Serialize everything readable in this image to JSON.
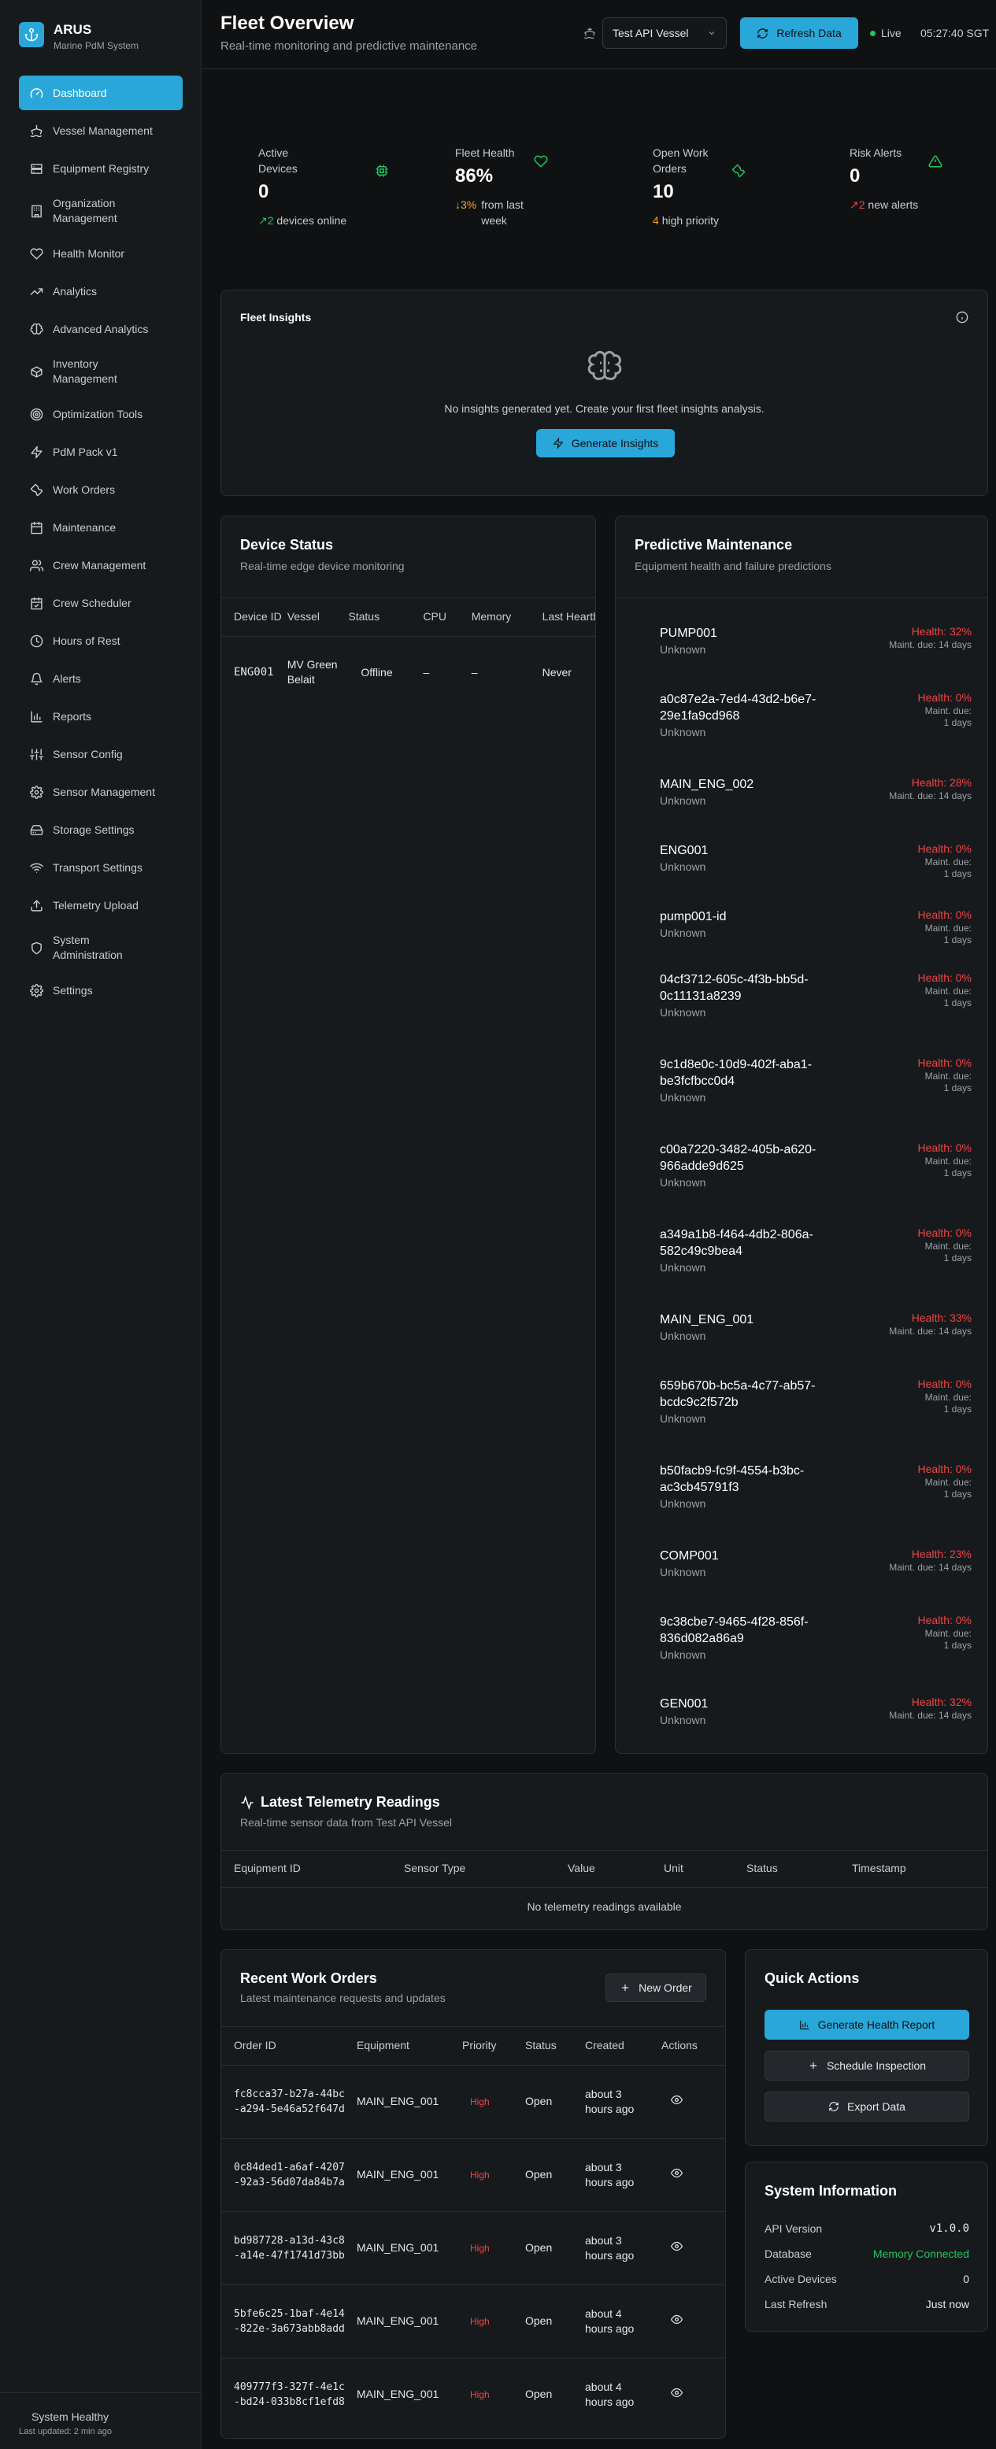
{
  "brand": {
    "name": "ARUS",
    "subtitle": "Marine PdM System"
  },
  "nav": [
    {
      "label": "Dashboard",
      "icon": "gauge-icon",
      "active": true
    },
    {
      "label": "Vessel Management",
      "icon": "ship-icon"
    },
    {
      "label": "Equipment Registry",
      "icon": "server-icon"
    },
    {
      "label": "Organization Management",
      "icon": "building-icon"
    },
    {
      "label": "Health Monitor",
      "icon": "heart-icon"
    },
    {
      "label": "Analytics",
      "icon": "trending-up-icon"
    },
    {
      "label": "Advanced Analytics",
      "icon": "brain-icon"
    },
    {
      "label": "Inventory Management",
      "icon": "package-icon"
    },
    {
      "label": "Optimization Tools",
      "icon": "target-icon"
    },
    {
      "label": "PdM Pack v1",
      "icon": "zap-icon"
    },
    {
      "label": "Work Orders",
      "icon": "wrench-icon"
    },
    {
      "label": "Maintenance",
      "icon": "calendar-icon"
    },
    {
      "label": "Crew Management",
      "icon": "users-icon"
    },
    {
      "label": "Crew Scheduler",
      "icon": "calendar-check-icon"
    },
    {
      "label": "Hours of Rest",
      "icon": "clock-icon"
    },
    {
      "label": "Alerts",
      "icon": "bell-icon"
    },
    {
      "label": "Reports",
      "icon": "bar-chart-icon"
    },
    {
      "label": "Sensor Config",
      "icon": "sliders-icon"
    },
    {
      "label": "Sensor Management",
      "icon": "gear-icon"
    },
    {
      "label": "Storage Settings",
      "icon": "hard-drive-icon"
    },
    {
      "label": "Transport Settings",
      "icon": "wifi-icon"
    },
    {
      "label": "Telemetry Upload",
      "icon": "upload-icon"
    },
    {
      "label": "System Administration",
      "icon": "shield-icon"
    },
    {
      "label": "Settings",
      "icon": "gear-icon"
    }
  ],
  "sidebar_footer": {
    "status": "System Healthy",
    "updated": "Last updated: 2 min ago"
  },
  "header": {
    "title": "Fleet Overview",
    "subtitle": "Real-time monitoring and predictive maintenance",
    "vessel": "Test API Vessel",
    "refresh_label": "Refresh Data",
    "live_label": "Live",
    "clock": "05:27:40 SGT"
  },
  "stats": [
    {
      "label": "Active Devices",
      "value": "0",
      "delta": "↗2",
      "note": "devices online"
    },
    {
      "label": "Fleet Health",
      "value": "86%",
      "delta": "↓3%",
      "note": "from last week"
    },
    {
      "label": "Open Work Orders",
      "value": "10",
      "delta": "4",
      "note": "high priority"
    },
    {
      "label": "Risk Alerts",
      "value": "0",
      "delta": "↗2",
      "note": "new alerts"
    }
  ],
  "insights": {
    "title": "Fleet Insights",
    "empty": "No insights generated yet. Create your first fleet insights analysis.",
    "button": "Generate Insights"
  },
  "device_status": {
    "title": "Device Status",
    "subtitle": "Real-time edge device monitoring",
    "columns": [
      "Device ID",
      "Vessel",
      "Status",
      "CPU",
      "Memory",
      "Last Heartbeat"
    ],
    "rows": [
      {
        "id": "ENG001",
        "vessel": "MV Green Belait",
        "status": "Offline",
        "cpu": "–",
        "memory": "–",
        "heartbeat": "Never"
      }
    ]
  },
  "predictive": {
    "title": "Predictive Maintenance",
    "subtitle": "Equipment health and failure predictions",
    "items": [
      {
        "name": "PUMP001",
        "state": "Unknown",
        "health": "Health: 32%",
        "due": "Maint. due: 14 days"
      },
      {
        "name": "a0c87e2a-7ed4-43d2-b6e7-29e1fa9cd968",
        "state": "Unknown",
        "health": "Health: 0%",
        "due": "Maint. due: 1 days"
      },
      {
        "name": "MAIN_ENG_002",
        "state": "Unknown",
        "health": "Health: 28%",
        "due": "Maint. due: 14 days"
      },
      {
        "name": "ENG001",
        "state": "Unknown",
        "health": "Health: 0%",
        "due": "Maint. due: 1 days"
      },
      {
        "name": "pump001-id",
        "state": "Unknown",
        "health": "Health: 0%",
        "due": "Maint. due: 1 days"
      },
      {
        "name": "04cf3712-605c-4f3b-bb5d-0c11131a8239",
        "state": "Unknown",
        "health": "Health: 0%",
        "due": "Maint. due: 1 days"
      },
      {
        "name": "9c1d8e0c-10d9-402f-aba1-be3fcfbcc0d4",
        "state": "Unknown",
        "health": "Health: 0%",
        "due": "Maint. due: 1 days"
      },
      {
        "name": "c00a7220-3482-405b-a620-966adde9d625",
        "state": "Unknown",
        "health": "Health: 0%",
        "due": "Maint. due: 1 days"
      },
      {
        "name": "a349a1b8-f464-4db2-806a-582c49c9bea4",
        "state": "Unknown",
        "health": "Health: 0%",
        "due": "Maint. due: 1 days"
      },
      {
        "name": "MAIN_ENG_001",
        "state": "Unknown",
        "health": "Health: 33%",
        "due": "Maint. due: 14 days"
      },
      {
        "name": "659b670b-bc5a-4c77-ab57-bcdc9c2f572b",
        "state": "Unknown",
        "health": "Health: 0%",
        "due": "Maint. due: 1 days"
      },
      {
        "name": "b50facb9-fc9f-4554-b3bc-ac3cb45791f3",
        "state": "Unknown",
        "health": "Health: 0%",
        "due": "Maint. due: 1 days"
      },
      {
        "name": "COMP001",
        "state": "Unknown",
        "health": "Health: 23%",
        "due": "Maint. due: 14 days"
      },
      {
        "name": "9c38cbe7-9465-4f28-856f-836d082a86a9",
        "state": "Unknown",
        "health": "Health: 0%",
        "due": "Maint. due: 1 days"
      },
      {
        "name": "GEN001",
        "state": "Unknown",
        "health": "Health: 32%",
        "due": "Maint. due: 14 days"
      }
    ]
  },
  "telemetry": {
    "title": "Latest Telemetry Readings",
    "subtitle": "Real-time sensor data from Test API Vessel",
    "columns": [
      "Equipment ID",
      "Sensor Type",
      "Value",
      "Unit",
      "Status",
      "Timestamp"
    ],
    "empty": "No telemetry readings available"
  },
  "work_orders": {
    "title": "Recent Work Orders",
    "subtitle": "Latest maintenance requests and updates",
    "new_button": "New Order",
    "columns": [
      "Order ID",
      "Equipment",
      "Priority",
      "Status",
      "Created",
      "Actions"
    ],
    "rows": [
      {
        "id": "fc8cca37-b27a-44bc-a294-5e46a52f647d",
        "equipment": "MAIN_ENG_001",
        "priority": "High",
        "status": "Open",
        "created": "about 3 hours ago"
      },
      {
        "id": "0c84ded1-a6af-4207-92a3-56d07da84b7a",
        "equipment": "MAIN_ENG_001",
        "priority": "High",
        "status": "Open",
        "created": "about 3 hours ago"
      },
      {
        "id": "bd987728-a13d-43c8-a14e-47f1741d73bb",
        "equipment": "MAIN_ENG_001",
        "priority": "High",
        "status": "Open",
        "created": "about 3 hours ago"
      },
      {
        "id": "5bfe6c25-1baf-4e14-822e-3a673abb8add",
        "equipment": "MAIN_ENG_001",
        "priority": "High",
        "status": "Open",
        "created": "about 4 hours ago"
      },
      {
        "id": "409777f3-327f-4e1c-bd24-033b8cf1efd8",
        "equipment": "MAIN_ENG_001",
        "priority": "High",
        "status": "Open",
        "created": "about 4 hours ago"
      }
    ]
  },
  "quick_actions": {
    "title": "Quick Actions",
    "health_report": "Generate Health Report",
    "schedule": "Schedule Inspection",
    "export": "Export Data"
  },
  "system_info": {
    "title": "System Information",
    "rows": [
      {
        "label": "API Version",
        "value": "v1.0.0"
      },
      {
        "label": "Database",
        "value": "Memory Connected"
      },
      {
        "label": "Active Devices",
        "value": "0"
      },
      {
        "label": "Last Refresh",
        "value": "Just now"
      }
    ]
  },
  "colors": {
    "accent": "#2aa7d9",
    "success": "#22c55e",
    "danger": "#ef4444",
    "warning": "#f5a524"
  }
}
